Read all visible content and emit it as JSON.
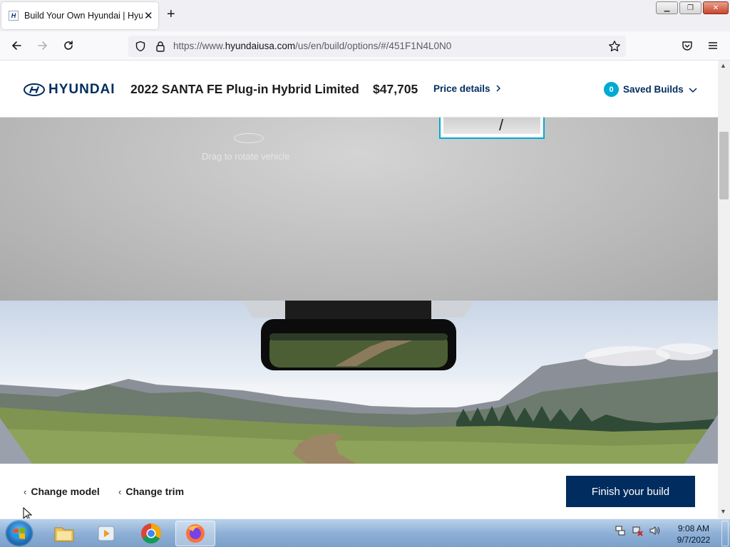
{
  "browser": {
    "tab_title": "Build Your Own Hyundai | Hyundai",
    "url_prefix": "https://www.",
    "url_host": "hyundaiusa.com",
    "url_path": "/us/en/build/options/#/451F1N4L0N0"
  },
  "header": {
    "brand": "HYUNDAI",
    "model": "2022 SANTA FE Plug-in Hybrid Limited",
    "price": "$47,705",
    "price_details": "Price details",
    "saved_count": "0",
    "saved_label": "Saved Builds"
  },
  "viewer": {
    "drag_hint": "Drag to rotate vehicle"
  },
  "footer": {
    "change_model": "Change model",
    "change_trim": "Change trim",
    "finish": "Finish your build"
  },
  "taskbar": {
    "time": "9:08 AM",
    "date": "9/7/2022"
  },
  "colors": {
    "brand_navy": "#002c5f",
    "accent_cyan": "#00aad2"
  },
  "icons": [
    "back-arrow-icon",
    "forward-arrow-icon",
    "reload-icon",
    "shield-icon",
    "lock-icon",
    "bookmark-star-icon",
    "pocket-icon",
    "menu-icon",
    "hyundai-logo",
    "chevron-right-icon",
    "chevron-down-icon",
    "rotate-icon",
    "chevron-left-icon"
  ]
}
